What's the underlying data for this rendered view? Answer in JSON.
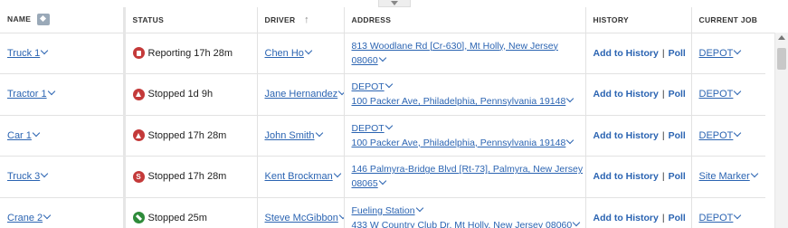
{
  "headers": {
    "name": "NAME",
    "status": "STATUS",
    "driver": "DRIVER",
    "address": "ADDRESS",
    "history": "HISTORY",
    "current_job": "CURRENT JOB"
  },
  "history_labels": {
    "add": "Add to History",
    "separator": "|",
    "poll": "Poll"
  },
  "rows": [
    {
      "name": "Truck 1",
      "status_icon": "reporting-icon",
      "status": "Reporting 17h 28m",
      "driver": "Chen Ho",
      "addr1": "813 Woodlane Rd [Cr-630], Mt Holly, New Jersey",
      "addr2": "08060",
      "job": "DEPOT"
    },
    {
      "name": "Tractor 1",
      "status_icon": "stopped-icon",
      "status": "Stopped 1d 9h",
      "driver": "Jane Hernandez",
      "addr1": "DEPOT",
      "addr2": "100 Packer Ave, Philadelphia, Pennsylvania 19148",
      "job": "DEPOT"
    },
    {
      "name": "Car 1",
      "status_icon": "stopped-icon",
      "status": "Stopped 17h 28m",
      "driver": "John Smith",
      "addr1": "DEPOT",
      "addr2": "100 Packer Ave, Philadelphia, Pennsylvania 19148",
      "job": "DEPOT"
    },
    {
      "name": "Truck 3",
      "status_icon": "stopped-s-icon",
      "status": "Stopped 17h 28m",
      "driver": "Kent Brockman",
      "addr1": "146 Palmyra-Bridge Blvd [Rt-73], Palmyra, New Jersey",
      "addr2": "08065",
      "job": "Site Marker"
    },
    {
      "name": "Crane 2",
      "status_icon": "moving-icon",
      "status": "Stopped 25m",
      "driver": "Steve McGibbon",
      "addr1": "Fueling Station",
      "addr2": "433 W Country Club Dr, Mt Holly, New Jersey 08060",
      "job": "DEPOT"
    }
  ]
}
